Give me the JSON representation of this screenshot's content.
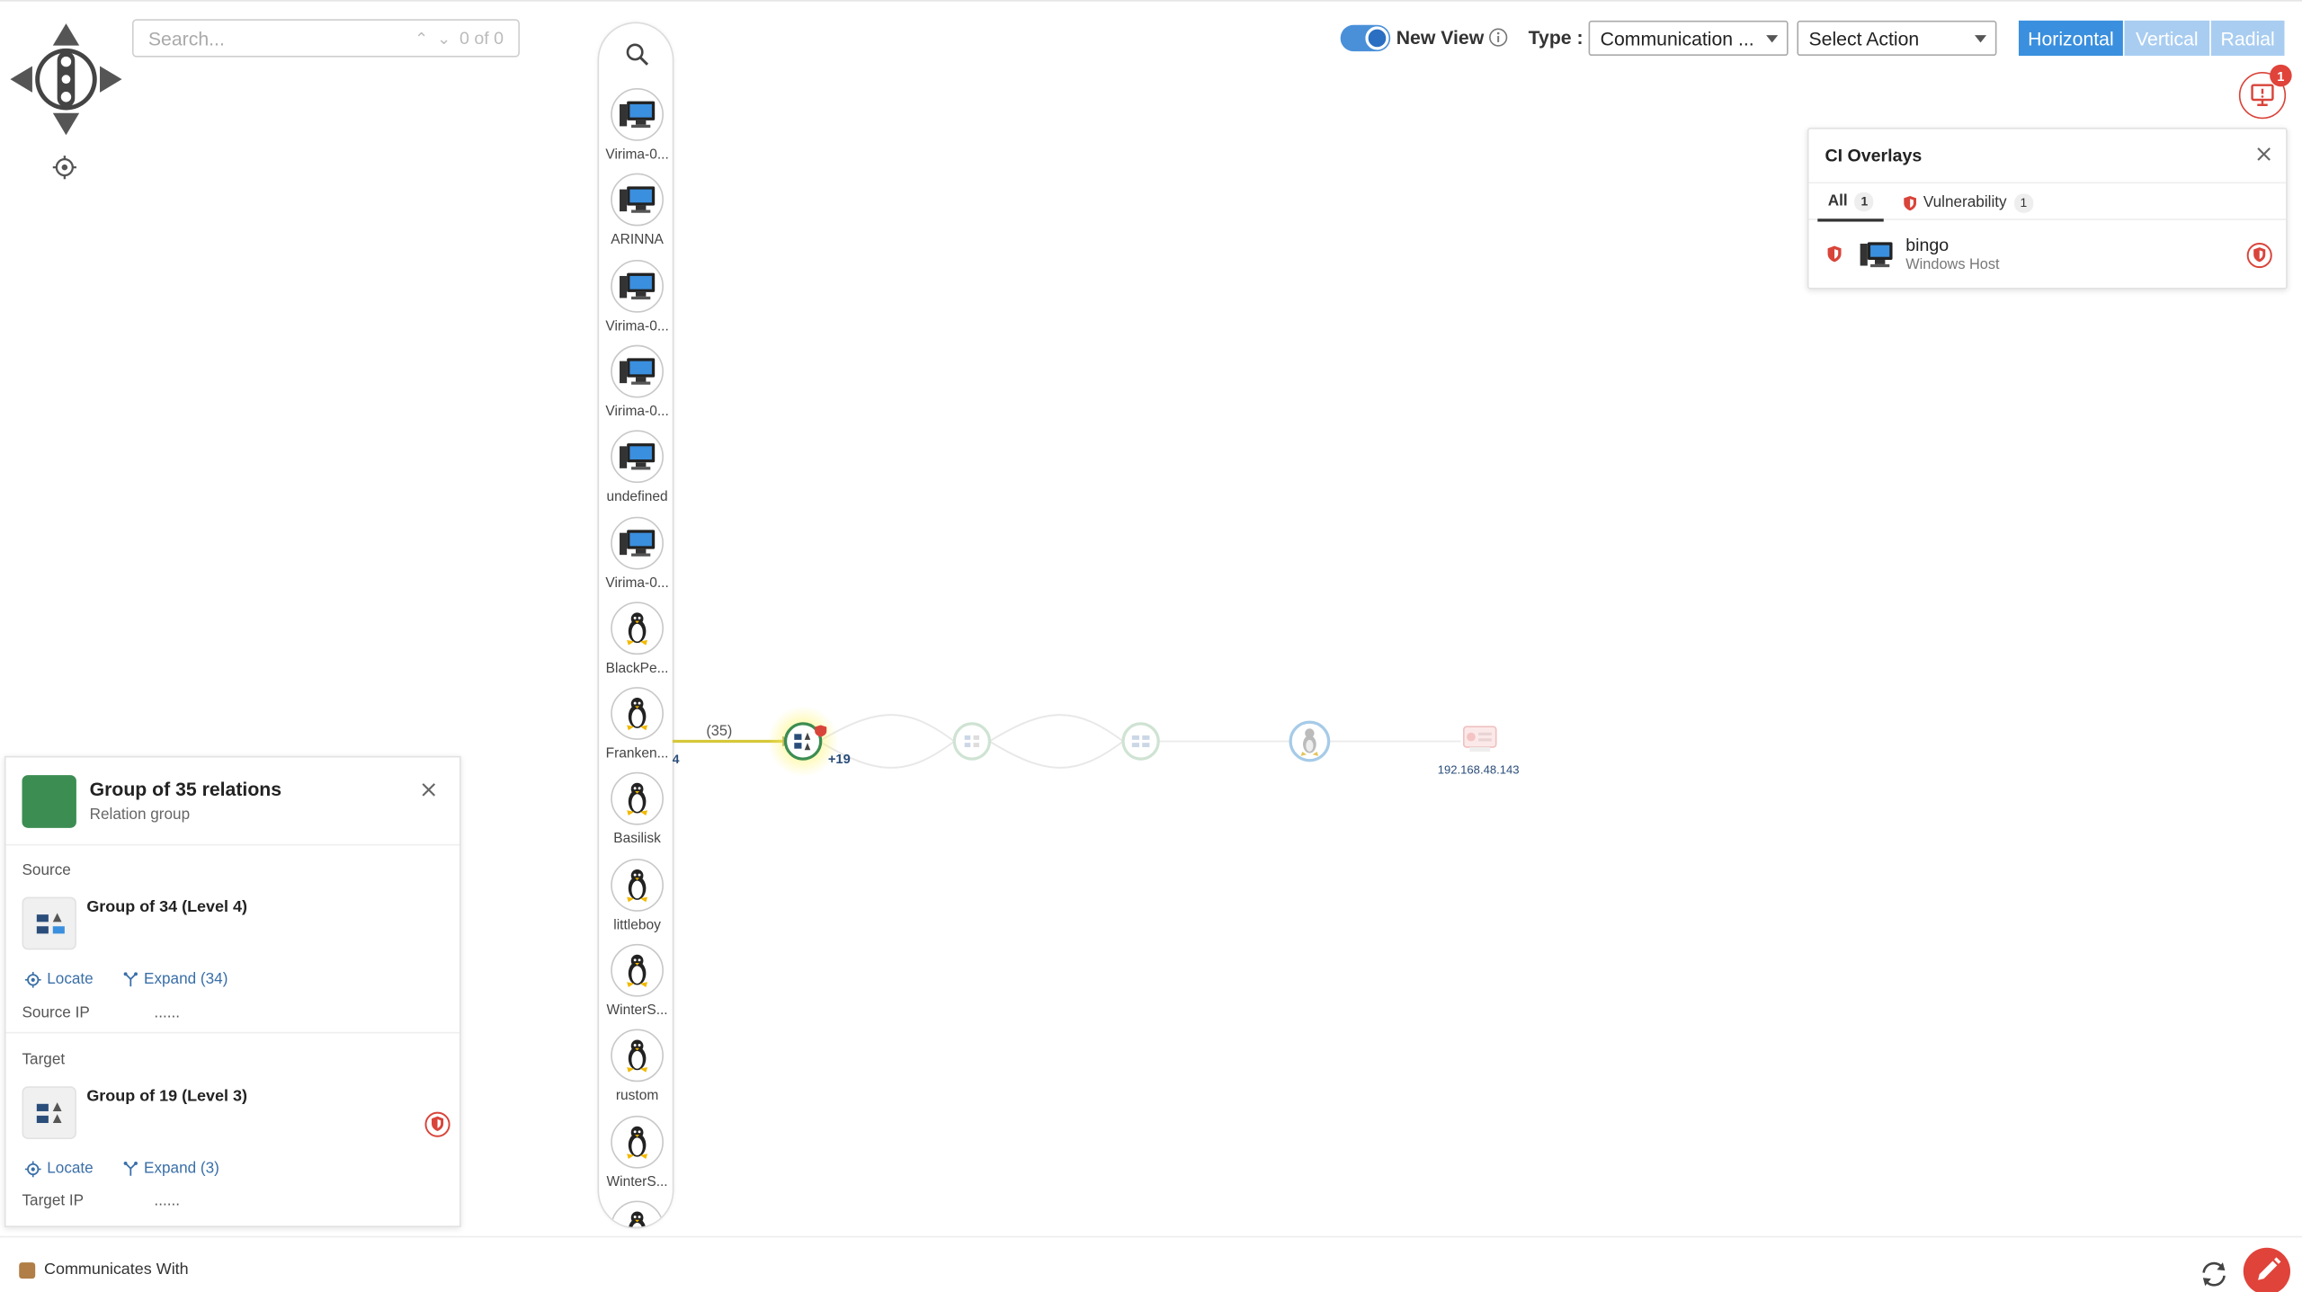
{
  "search": {
    "placeholder": "Search...",
    "counter": "0 of 0"
  },
  "ci_strip": {
    "items": [
      {
        "label": "Virima-0...",
        "icon": "windows-host-icon"
      },
      {
        "label": "ARINNA",
        "icon": "windows-host-icon"
      },
      {
        "label": "Virima-0...",
        "icon": "windows-host-icon"
      },
      {
        "label": "Virima-0...",
        "icon": "windows-host-icon"
      },
      {
        "label": "undefined",
        "icon": "windows-host-icon"
      },
      {
        "label": "Virima-0...",
        "icon": "windows-host-icon"
      },
      {
        "label": "BlackPe...",
        "icon": "linux-host-icon"
      },
      {
        "label": "Franken...",
        "icon": "linux-host-icon"
      },
      {
        "label": "Basilisk",
        "icon": "linux-host-icon"
      },
      {
        "label": "littleboy",
        "icon": "linux-host-icon"
      },
      {
        "label": "WinterS...",
        "icon": "linux-host-icon"
      },
      {
        "label": "rustom",
        "icon": "linux-host-icon"
      },
      {
        "label": "WinterS...",
        "icon": "linux-host-icon"
      }
    ]
  },
  "toolbar": {
    "new_view_label": "New View",
    "new_view_on": true,
    "type_label": "Type :",
    "type_value": "Communication ...",
    "action_value": "Select Action",
    "layouts": {
      "horizontal": "Horizontal",
      "vertical": "Vertical",
      "radial": "Radial"
    },
    "active_layout": "Horizontal",
    "overlay_badge": "1",
    "accent": "#3a8fde",
    "alert_color": "#e0433a"
  },
  "ci_overlays": {
    "title": "CI Overlays",
    "tabs": [
      {
        "label": "All",
        "count": "1"
      },
      {
        "label": "Vulnerability",
        "count": "1"
      }
    ],
    "items": [
      {
        "name": "bingo",
        "type": "Windows Host"
      }
    ]
  },
  "graph": {
    "edge_count_label": "(35)",
    "left_fragment": "4",
    "extra_count": "+19",
    "ip_label": "192.168.48.143"
  },
  "detail": {
    "title": "Group of 35 relations",
    "subtitle": "Relation group",
    "group_color": "#3c8d52",
    "source": {
      "section": "Source",
      "name": "Group of 34 (Level 4)",
      "locate": "Locate",
      "expand": "Expand (34)",
      "ip_label": "Source IP",
      "ip_value": "......"
    },
    "target": {
      "section": "Target",
      "name": "Group of 19 (Level 3)",
      "locate": "Locate",
      "expand": "Expand (3)",
      "ip_label": "Target IP",
      "ip_value": "......"
    }
  },
  "legend": {
    "label": "Communicates With",
    "color": "#b07e46"
  }
}
